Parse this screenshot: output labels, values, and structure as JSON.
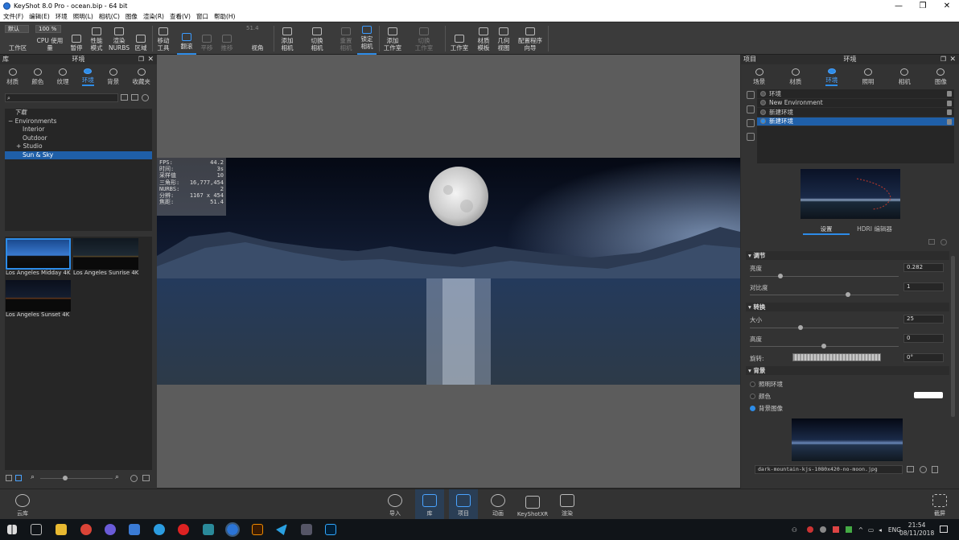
{
  "window": {
    "title": "KeyShot 8.0 Pro - ocean.bip - 64 bit",
    "minimize": "—",
    "maximize": "❐",
    "close": "✕"
  },
  "menu": [
    "文件(F)",
    "编辑(E)",
    "环境",
    "照明(L)",
    "相机(C)",
    "图像",
    "渲染(R)",
    "查看(V)",
    "窗口",
    "帮助(H)"
  ],
  "toolbar": {
    "preset": "默认",
    "cpu_percent": "100 %",
    "workspace": "工作区",
    "cpu_usage": "CPU 使用量",
    "pause": "暂停",
    "perf_mode": "性能\n模式",
    "render_nurbs": "渲染\nNURBS",
    "region": "区域",
    "move_tool": "移动\n工具",
    "tumble": "翻滚",
    "pan": "平移",
    "dolly": "推移",
    "fov_value": "51.4",
    "perspective": "视角",
    "add_camera": "添加\n相机",
    "switch_camera": "切换\n相机",
    "reset_camera": "重置\n相机",
    "lock_camera": "锁定\n相机",
    "add_studio": "添加\n工作室",
    "switch_studio": "切换\n工作室",
    "studio": "工作室",
    "material_template": "材质\n模板",
    "geometry_view": "几何\n视图",
    "config_wizard": "配置程序\n向导"
  },
  "library": {
    "header_left": "库",
    "title": "环境",
    "tabs": [
      "材质",
      "颜色",
      "纹理",
      "环境",
      "背景",
      "收藏夹"
    ],
    "active_tab": "环境",
    "tree": [
      "下载",
      "Environments",
      "Interior",
      "Outdoor",
      "Studio",
      "Sun & Sky"
    ],
    "selected_tree": "Sun & Sky",
    "thumbnails": [
      "Los Angeles Midday 4K",
      "Los Angeles Sunrise 4K",
      "Los Angeles Sunset 4K"
    ]
  },
  "stats": [
    {
      "k": "FPS:",
      "v": "44.2"
    },
    {
      "k": "时间:",
      "v": "3s"
    },
    {
      "k": "采样值",
      "v": "10"
    },
    {
      "k": "三角形:",
      "v": "16,777,454"
    },
    {
      "k": "NURBS:",
      "v": "2"
    },
    {
      "k": "分辨:",
      "v": "1167 x 454"
    },
    {
      "k": "焦距:",
      "v": "51.4"
    }
  ],
  "project": {
    "header_left": "项目",
    "title": "环境",
    "tabs": [
      "场景",
      "材质",
      "环境",
      "照明",
      "相机",
      "图像"
    ],
    "active_tab": "环境",
    "environments": [
      "环境",
      "New Environment",
      "新建环境",
      "新建环境"
    ],
    "selected_env_index": 3,
    "subtabs": [
      "设置",
      "HDRI 编辑器"
    ],
    "sections": {
      "adjust": "调节",
      "brightness": "亮度",
      "brightness_value": "0.282",
      "contrast": "对比度",
      "contrast_value": "1",
      "transform": "转换",
      "size": "大小",
      "size_value": "25",
      "height": "高度",
      "height_value": "0",
      "rotation": "旋转:",
      "rotation_value": "0°",
      "background": "背景",
      "bg_lighting": "照明环境",
      "bg_color": "颜色",
      "bg_image": "背景图像",
      "bg_file": "dark-mountain-kjs-1080x420-no-moon.jpg"
    }
  },
  "bottom": {
    "cloud": "云库",
    "import": "导入",
    "library": "库",
    "project": "项目",
    "animation": "动画",
    "keyshotxr": "KeyShotXR",
    "render": "渲染",
    "screenshot": "截屏"
  },
  "taskbar": {
    "lang": "ENG",
    "time": "21:54",
    "date": "08/11/2018"
  },
  "colors": {
    "accent": "#2d8ce8",
    "selected": "#1f5fa8"
  }
}
